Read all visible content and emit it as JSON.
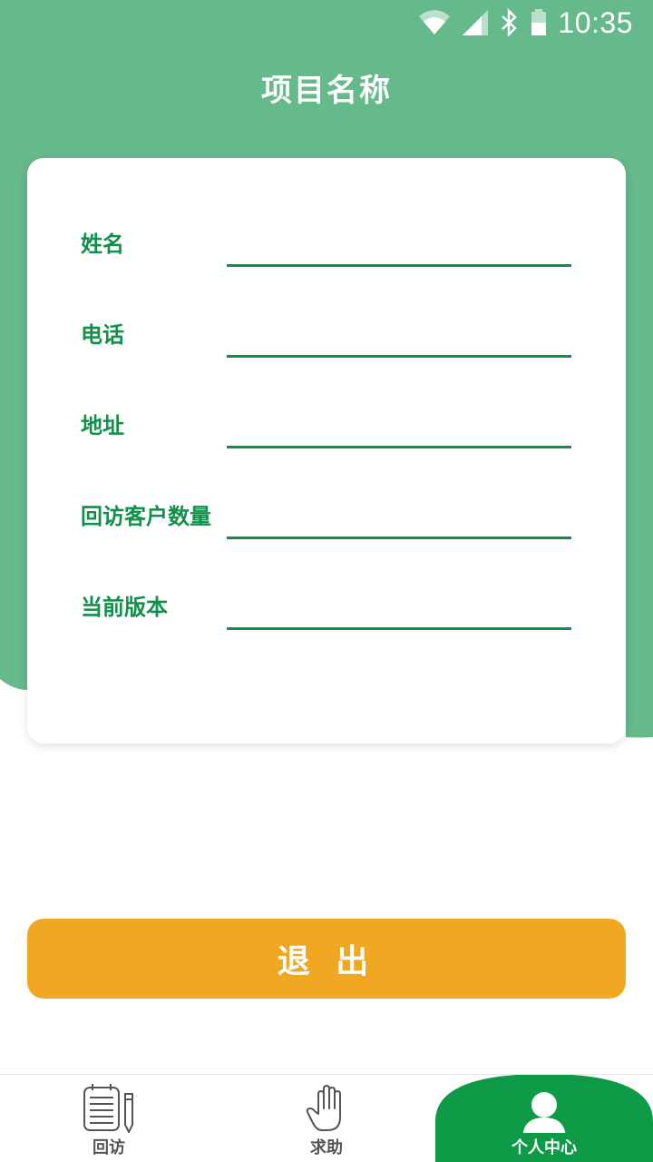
{
  "colors": {
    "header_green": "#66b98a",
    "field_green": "#11904a",
    "nav_active_green": "#0f9a48",
    "logout_orange": "#f0a722",
    "card_bg": "#ffffff"
  },
  "status_bar": {
    "time": "10:35",
    "icons": [
      "wifi-icon",
      "cell-signal-icon",
      "bluetooth-icon",
      "battery-icon"
    ]
  },
  "header": {
    "title": "项目名称"
  },
  "form": {
    "fields": [
      {
        "label": "姓名",
        "value": ""
      },
      {
        "label": "电话",
        "value": ""
      },
      {
        "label": "地址",
        "value": ""
      },
      {
        "label": "回访客户数量",
        "value": ""
      },
      {
        "label": "当前版本",
        "value": ""
      }
    ]
  },
  "actions": {
    "logout_label": "退 出"
  },
  "bottom_nav": {
    "items": [
      {
        "label": "回访",
        "icon": "notepad-pencil-icon",
        "active": false
      },
      {
        "label": "求助",
        "icon": "hand-icon",
        "active": false
      },
      {
        "label": "个人中心",
        "icon": "person-icon",
        "active": true
      }
    ]
  }
}
